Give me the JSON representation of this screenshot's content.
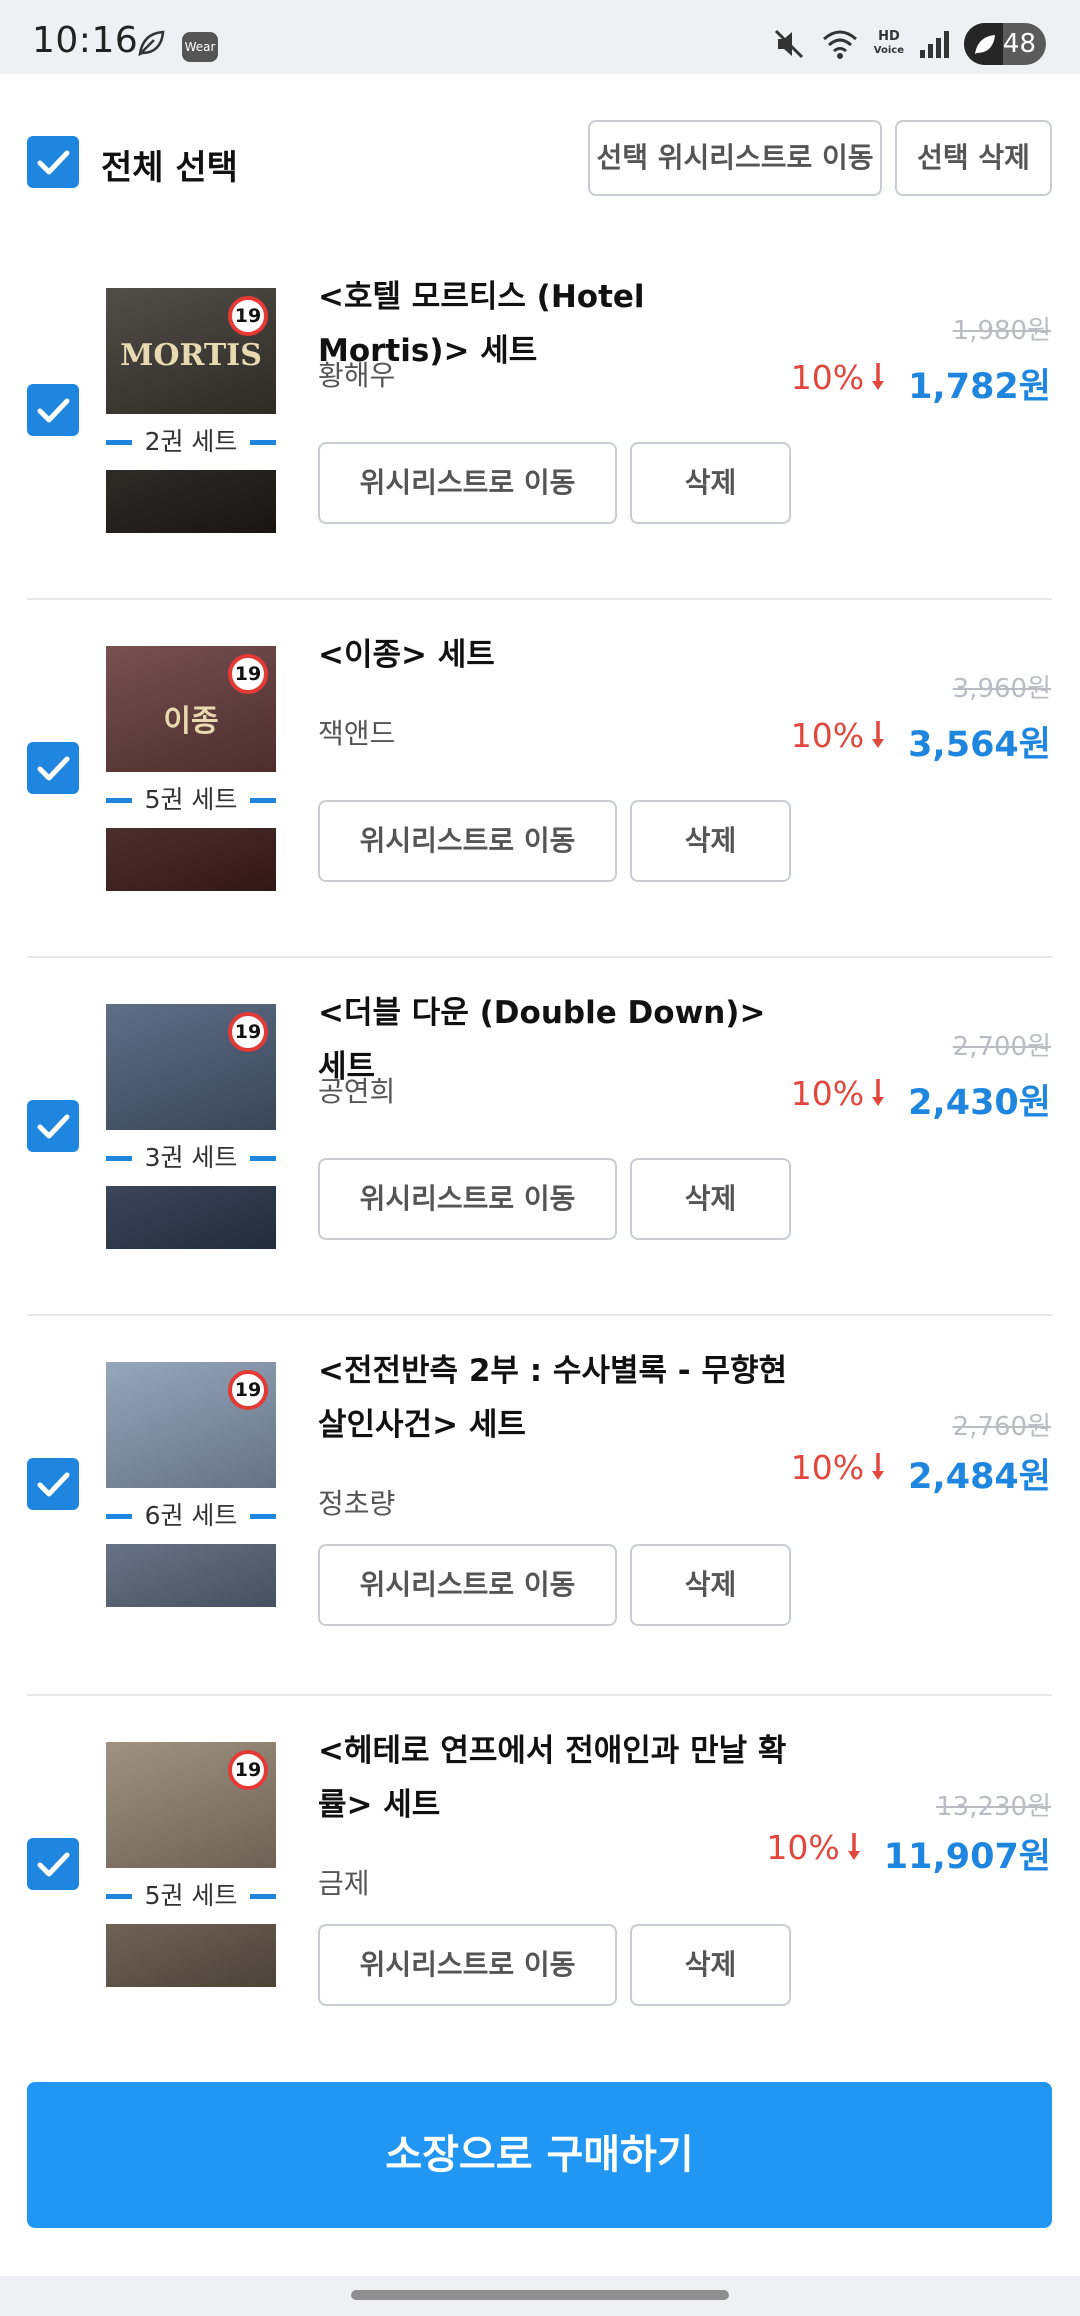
{
  "status_bar": {
    "time": "10:16",
    "wear_label": "Wear",
    "hd_label": "HD",
    "voice_label": "Voice",
    "battery_text": "48",
    "battery_level": 0.48,
    "icons": [
      "leaf-icon",
      "wear-icon",
      "mute-icon",
      "wifi-icon",
      "hd-voice-icon",
      "signal-icon",
      "battery-icon"
    ]
  },
  "header": {
    "select_all_label": "전체 선택",
    "move_selected_label": "선택 위시리스트로 이동",
    "delete_selected_label": "선택 삭제"
  },
  "items": [
    {
      "title": "<호텔 모르티스 (Hotel Mortis)> 세트",
      "author": "황해우",
      "set_label": "2권 세트",
      "age_badge": "19",
      "original_price": "1,980원",
      "discount": "10%",
      "price": "1,782원",
      "cover_color": "#2b2620",
      "cover_text": "MORTIS",
      "checked": true
    },
    {
      "title": "<이종> 세트",
      "author": "잭앤드",
      "set_label": "5권 세트",
      "age_badge": "19",
      "original_price": "3,960원",
      "discount": "10%",
      "price": "3,564원",
      "cover_color": "#5a2a2a",
      "cover_text": "이종",
      "checked": true
    },
    {
      "title": "<더블 다운 (Double Down)> 세트",
      "author": "공연희",
      "set_label": "3권 세트",
      "age_badge": "19",
      "original_price": "2,700원",
      "discount": "10%",
      "price": "2,430원",
      "cover_color": "#3c4f6b",
      "cover_text": "",
      "checked": true
    },
    {
      "title": "<전전반측 2부 : 수사별록 - 무향현 살인사건> 세트",
      "author": "정초량",
      "set_label": "6권 세트",
      "age_badge": "19",
      "original_price": "2,760원",
      "discount": "10%",
      "price": "2,484원",
      "cover_color": "#7f93ad",
      "cover_text": "",
      "checked": true
    },
    {
      "title": "<헤테로 연프에서 전애인과 만날 확률> 세트",
      "author": "금제",
      "set_label": "5권 세트",
      "age_badge": "19",
      "original_price": "13,230원",
      "discount": "10%",
      "price": "11,907원",
      "cover_color": "#8a7a66",
      "cover_text": "",
      "checked": true
    }
  ],
  "item_buttons": {
    "wishlist_label": "위시리스트로 이동",
    "delete_label": "삭제"
  },
  "buy_button_label": "소장으로 구매하기",
  "colors": {
    "accent": "#1f86e0",
    "buy_button": "#2196f3",
    "discount_red": "#e2473e",
    "strike_gray": "#b9bdc2"
  }
}
